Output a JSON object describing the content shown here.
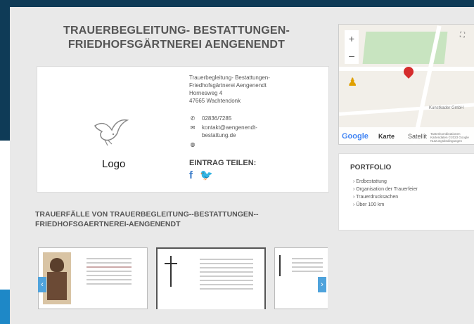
{
  "header": {
    "title_line1": "TRAUERBEGLEITUNG- BESTATTUNGEN-",
    "title_line2": "FRIEDHOFSGÄRTNEREI AENGENENDT"
  },
  "card": {
    "logo_label": "Logo",
    "address": [
      "Trauerbegleitung- Bestattungen-",
      "Friedhofsgärtnerei Aengenendt",
      "Hornesweg 4",
      "47665 Wachtendonk"
    ],
    "phone": "02836/7285",
    "email": "kontakt@aengenendt-bestattung.de",
    "share_title": "EINTRAG TEILEN:",
    "facebook": "f",
    "twitter": "🐦"
  },
  "section": {
    "title_line1": "TRAUERFÄLLE VON TRAUERBEGLEITUNG--BESTATTUNGEN--",
    "title_line2": "FRIEDHOFSGAERTNEREI-AENGENENDT"
  },
  "map": {
    "zoom_in": "+",
    "zoom_out": "–",
    "fullscreen": "⛶",
    "label": "Kunstkader GmbH",
    "google": "Google",
    "type_map": "Karte",
    "type_satellite": "Satellit",
    "credit": "Tastenkombinationen  Kartendaten ©2023 Google  Nutzungsbedingungen"
  },
  "portfolio": {
    "title": "PORTFOLIO",
    "items": [
      "Erdbestattung",
      "Organisation der Trauerfeier",
      "Trauerdrucksachen",
      "Über 100 km"
    ]
  },
  "colors": {
    "navy": "#0f3b57",
    "accent": "#4fa3dc",
    "pin": "#d52c2c"
  }
}
